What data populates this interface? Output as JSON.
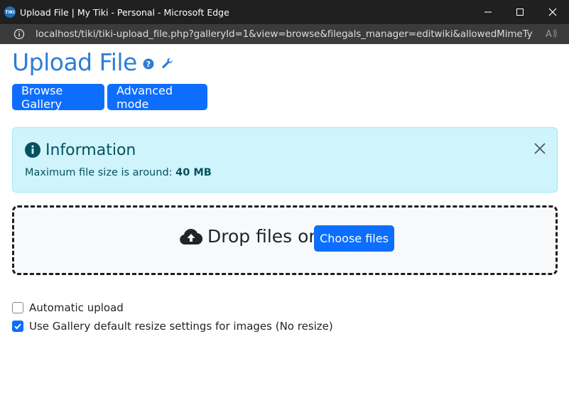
{
  "window": {
    "title": "Upload File | My Tiki - Personal - Microsoft Edge",
    "app_icon_text": "TIKI"
  },
  "address_bar": {
    "url": "localhost/tiki/tiki-upload_file.php?galleryId=1&view=browse&filegals_manager=editwiki&allowedMimeTypes=i..."
  },
  "page": {
    "title": "Upload File",
    "buttons": {
      "browse_gallery": "Browse Gallery",
      "advanced_mode": "Advanced mode"
    }
  },
  "alert": {
    "title": "Information",
    "text_prefix": "Maximum file size is around: ",
    "max_size": "40 MB",
    "color": "#cff4fc"
  },
  "dropzone": {
    "text": "Drop files or",
    "choose_button": "Choose files"
  },
  "options": [
    {
      "label": "Automatic upload",
      "checked": false
    },
    {
      "label": "Use Gallery default resize settings for images (No resize)",
      "checked": true
    }
  ],
  "colors": {
    "accent": "#0d6efd",
    "title": "#2f7dd6",
    "titlebar": "#202020"
  }
}
